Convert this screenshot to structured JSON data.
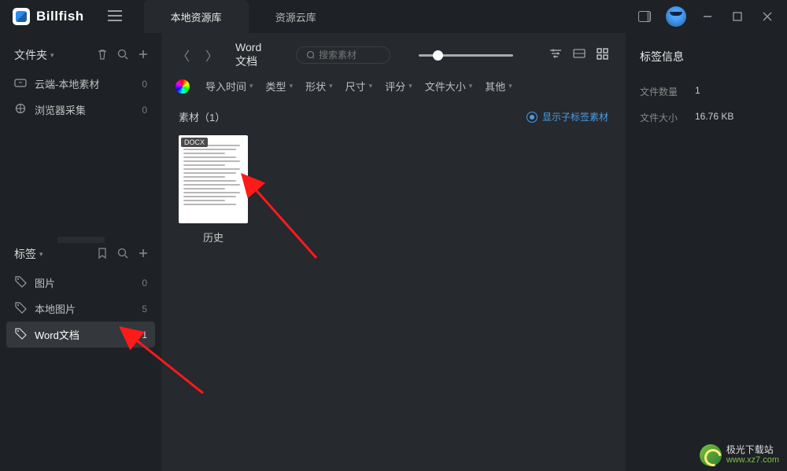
{
  "app_name": "Billfish",
  "tabs": {
    "local": "本地资源库",
    "cloud": "资源云库"
  },
  "sidebar": {
    "folders": {
      "title": "文件夹",
      "items": [
        {
          "icon": "cloud-to-local-icon",
          "label": "云端-本地素材",
          "count": "0"
        },
        {
          "icon": "browser-collect-icon",
          "label": "浏览器采集",
          "count": "0"
        }
      ]
    },
    "tags": {
      "title": "标签",
      "items": [
        {
          "label": "图片",
          "count": "0"
        },
        {
          "label": "本地图片",
          "count": "5"
        },
        {
          "label": "Word文档",
          "count": "1"
        }
      ]
    }
  },
  "toolbar": {
    "breadcrumb": "Word文档",
    "search_placeholder": "搜索素材"
  },
  "filters": {
    "import_time": "导入时间",
    "type": "类型",
    "shape": "形状",
    "size": "尺寸",
    "rating": "评分",
    "filesize": "文件大小",
    "other": "其他"
  },
  "content": {
    "header": "素材（1）",
    "show_sub_tags": "显示子标签素材",
    "cards": [
      {
        "badge": "DOCX",
        "name": "历史"
      }
    ]
  },
  "rightpane": {
    "title": "标签信息",
    "rows": [
      {
        "key": "文件数量",
        "val": "1"
      },
      {
        "key": "文件大小",
        "val": "16.76 KB"
      }
    ]
  },
  "watermark": {
    "line1": "极光下载站",
    "line2": "www.xz7.com"
  }
}
